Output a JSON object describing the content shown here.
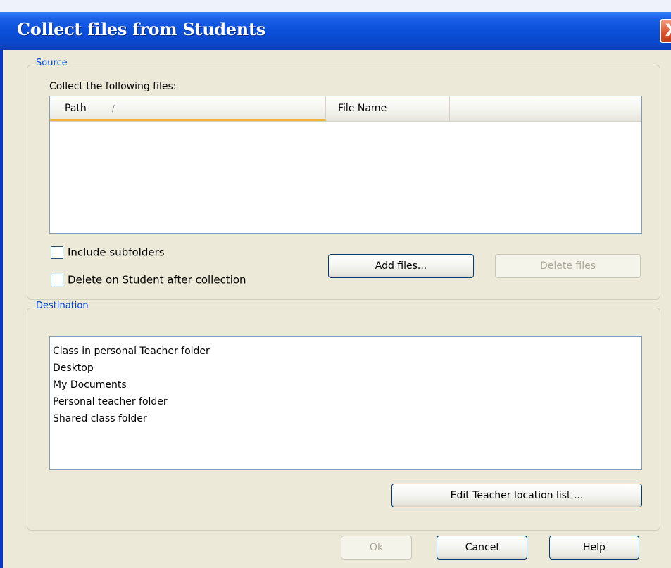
{
  "window": {
    "title": "Collect files from Students",
    "close_glyph": "X"
  },
  "source": {
    "group_label": "Source",
    "list_label": "Collect the following files:",
    "columns": [
      {
        "label": "Path",
        "sort_indicator": "/"
      },
      {
        "label": "File Name"
      }
    ],
    "rows": [],
    "include_subfolders": {
      "label": "Include subfolders",
      "checked": false
    },
    "delete_after": {
      "label": "Delete on Student after collection",
      "checked": false
    },
    "add_files_label": "Add files...",
    "delete_files_label": "Delete files"
  },
  "destination": {
    "group_label": "Destination",
    "items": [
      "Class in personal Teacher folder",
      "Desktop",
      "My Documents",
      "Personal teacher folder",
      "Shared class folder"
    ],
    "edit_label": "Edit Teacher location list ..."
  },
  "footer": {
    "ok_label": "Ok",
    "cancel_label": "Cancel",
    "help_label": "Help"
  }
}
